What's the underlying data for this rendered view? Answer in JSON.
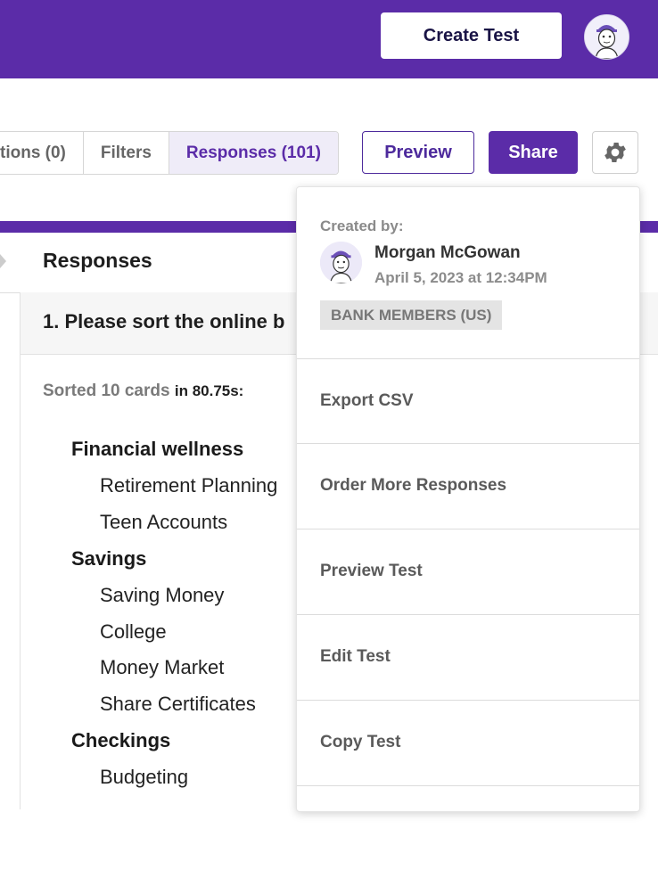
{
  "header": {
    "create_button": "Create Test"
  },
  "tabs": [
    "tions (0)",
    "Filters",
    "Responses (101)"
  ],
  "actions": {
    "preview": "Preview",
    "share": "Share"
  },
  "responses": {
    "title": "Responses",
    "question": "1. Please sort the online b",
    "sorted_label": "Sorted 10 cards",
    "sorted_time": "in 80.75s:",
    "groups": [
      {
        "name": "Financial wellness",
        "items": [
          "Retirement Planning",
          "Teen Accounts"
        ]
      },
      {
        "name": "Savings",
        "items": [
          "Saving Money",
          "College",
          "Money Market",
          "Share Certificates"
        ]
      },
      {
        "name": "Checkings",
        "items": [
          "Budgeting"
        ]
      }
    ]
  },
  "dropdown": {
    "created_label": "Created by:",
    "creator_name": "Morgan McGowan",
    "created_date": "April 5, 2023 at 12:34PM",
    "audience": "BANK MEMBERS (US)",
    "menu": [
      "Export CSV",
      "Order More Responses",
      "Preview Test",
      "Edit Test",
      "Copy Test"
    ]
  },
  "colors": {
    "brand": "#5b2ca8",
    "active_tab_bg": "#efecf8"
  }
}
